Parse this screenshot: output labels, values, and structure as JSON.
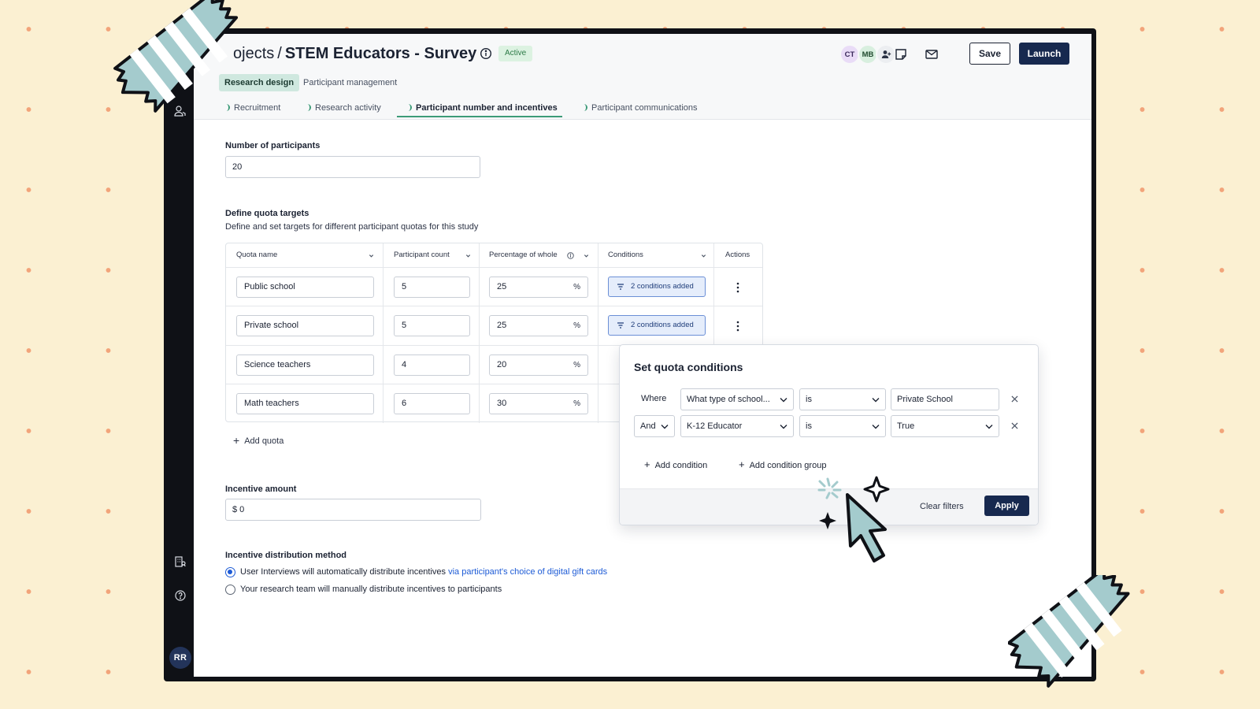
{
  "header": {
    "breadcrumb_parent": "Projects",
    "breadcrumb_parent_visible": "ojects",
    "separator": "/",
    "project_title": "STEM Educators - Survey",
    "status": "Active",
    "collaborators": [
      "CT",
      "MB"
    ],
    "save_label": "Save",
    "launch_label": "Launch"
  },
  "tabs": {
    "primary": "Research design",
    "secondary": "Participant management"
  },
  "steps": [
    {
      "label": "Recruitment"
    },
    {
      "label": "Research activity"
    },
    {
      "label": "Participant number and incentives"
    },
    {
      "label": "Participant communications"
    }
  ],
  "participants": {
    "label": "Number of participants",
    "value": "20"
  },
  "quota": {
    "title": "Define quota targets",
    "description": "Define and set targets for different participant quotas for this study",
    "columns": [
      "Quota name",
      "Participant count",
      "Percentage of whole",
      "Conditions",
      "Actions"
    ],
    "rows": [
      {
        "name": "Public school",
        "count": "5",
        "percent": "25",
        "conditions": "2 conditions added"
      },
      {
        "name": "Private school",
        "count": "5",
        "percent": "25",
        "conditions": "2 conditions added"
      },
      {
        "name": "Science teachers",
        "count": "4",
        "percent": "20"
      },
      {
        "name": "Math teachers",
        "count": "6",
        "percent": "30"
      }
    ],
    "percent_symbol": "%",
    "add_label": "Add quota"
  },
  "incentive": {
    "label": "Incentive amount",
    "value": "$ 0"
  },
  "distribution": {
    "label": "Incentive distribution method",
    "option1_text": "User Interviews will automatically distribute incentives",
    "option1_link": "via participant's choice of digital gift cards",
    "option2_text": "Your research team will manually distribute incentives to participants",
    "selected": 1
  },
  "popover": {
    "title": "Set quota conditions",
    "rows": [
      {
        "connector": "Where",
        "field": "What type of school...",
        "operator": "is",
        "value": "Private School"
      },
      {
        "connector": "And",
        "field": "K-12 Educator",
        "operator": "is",
        "value": "True"
      }
    ],
    "add_condition": "Add condition",
    "add_group": "Add condition group",
    "clear": "Clear filters",
    "apply": "Apply"
  },
  "user": {
    "initials": "RR"
  },
  "colors": {
    "accent_navy": "#17294f",
    "active_tab_green": "#cfe8df",
    "link_blue": "#1d5bd6",
    "decor_teal": "#a4cbcd",
    "page_bg": "#fbf0d2",
    "dot_orange": "#f2a47a"
  }
}
